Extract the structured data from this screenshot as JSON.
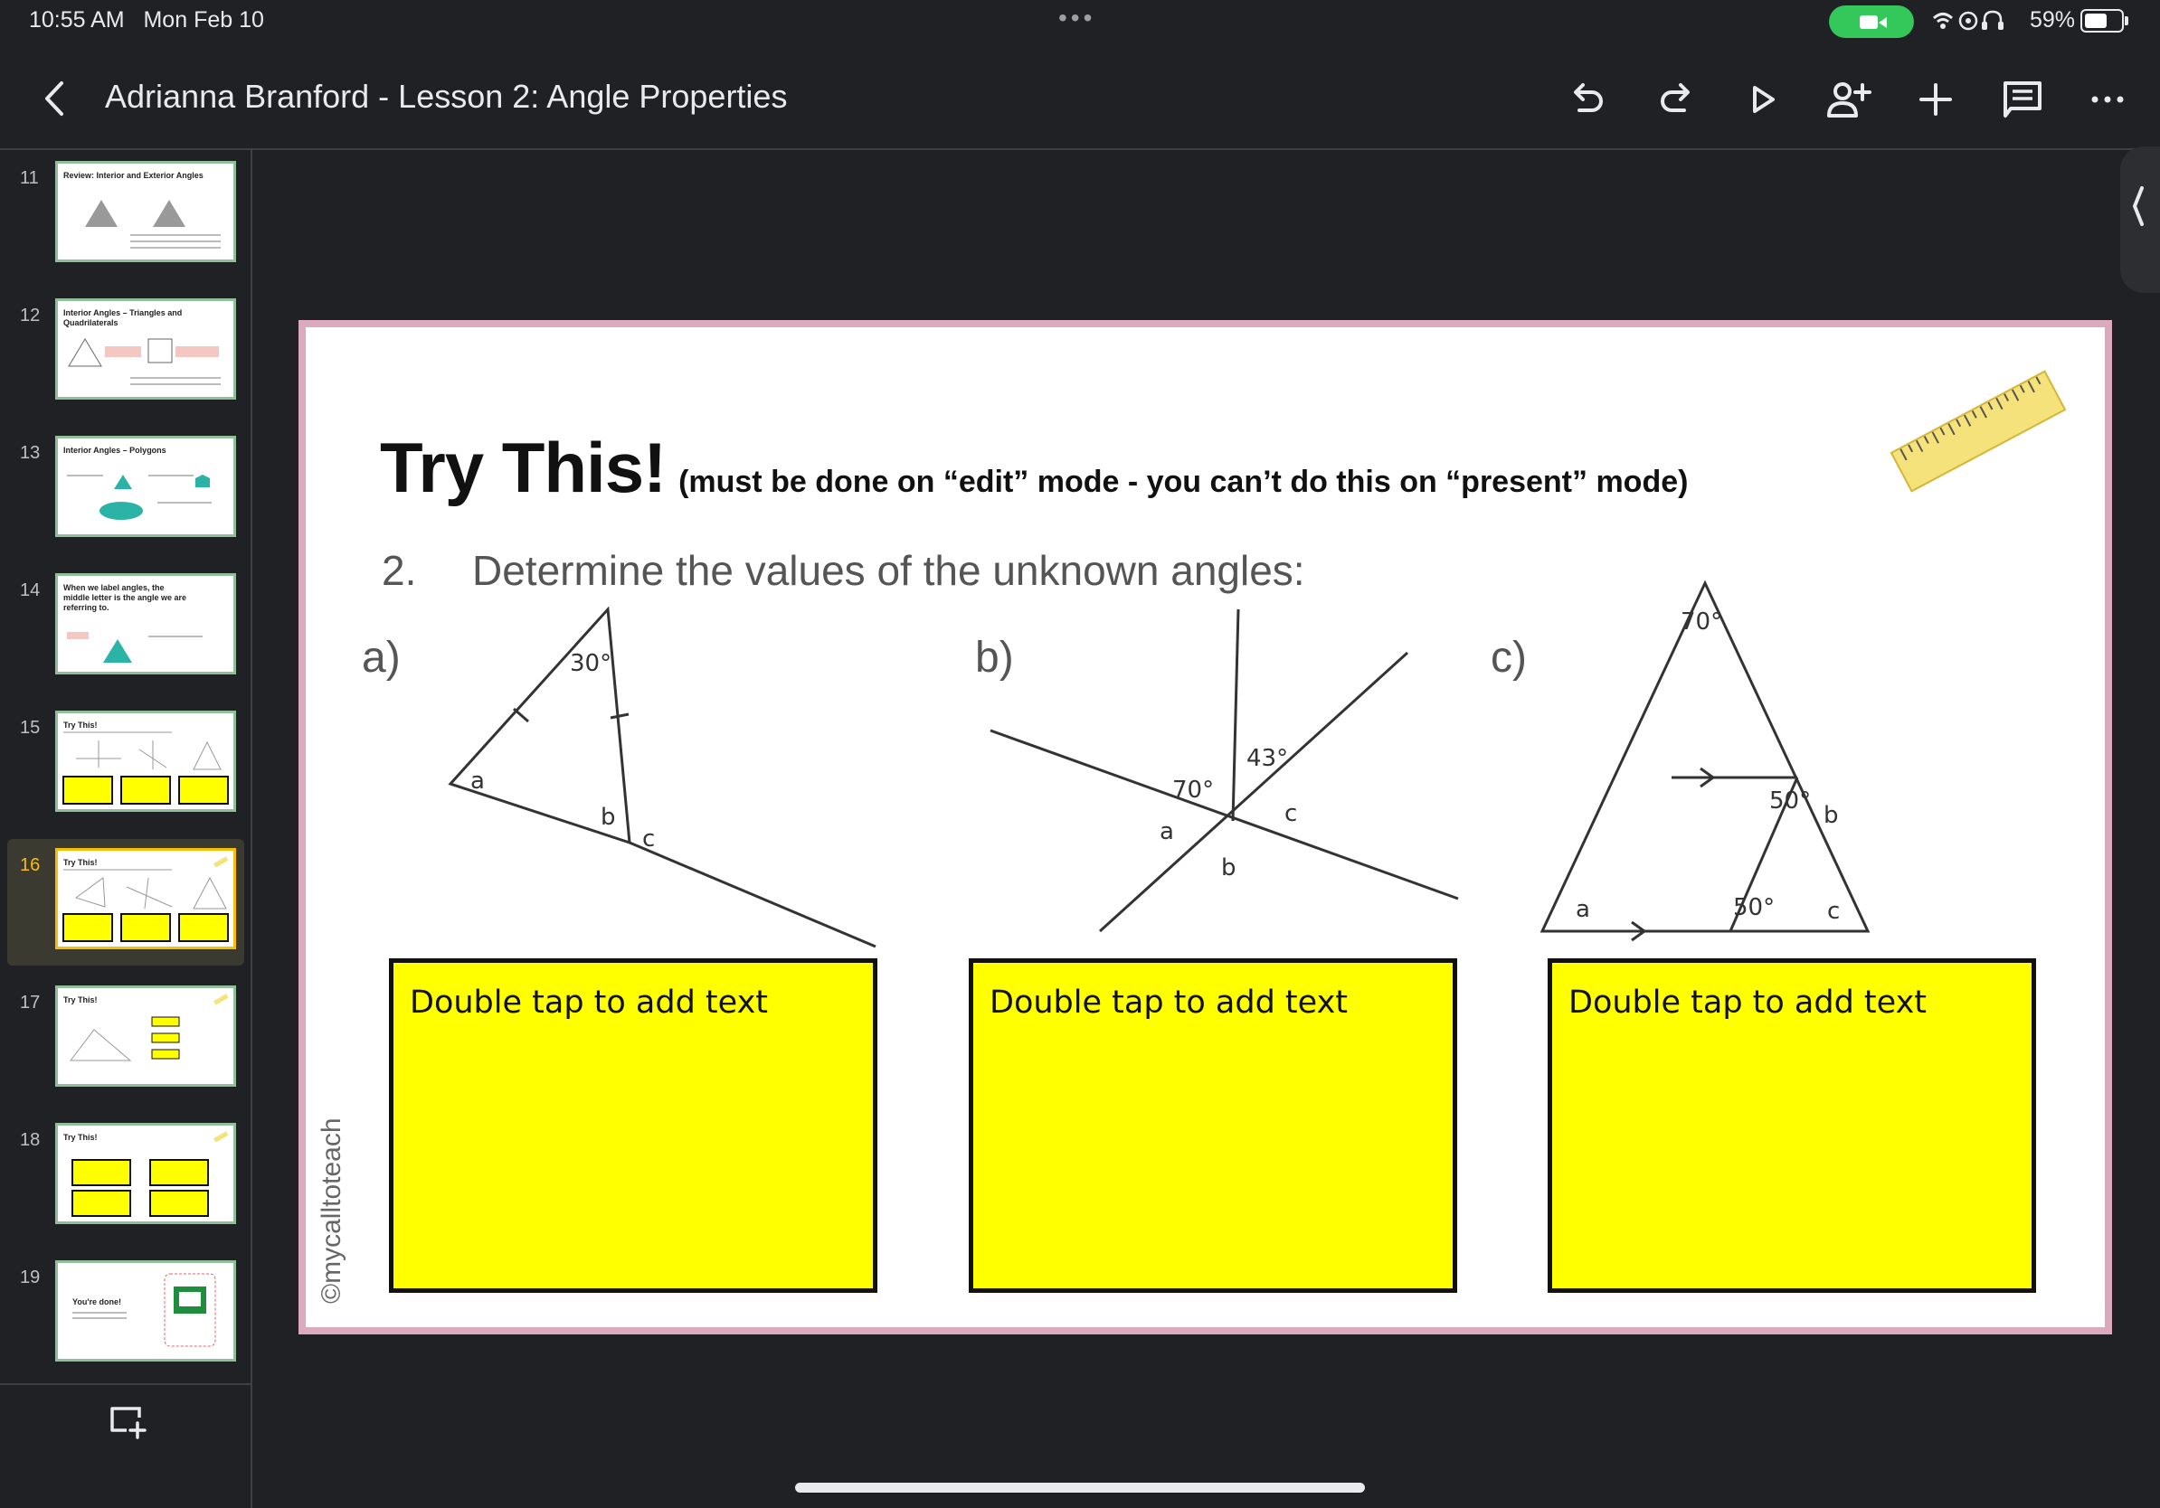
{
  "status": {
    "time": "10:55 AM",
    "date": "Mon Feb 10",
    "battery": "59%"
  },
  "toolbar": {
    "title": "Adrianna Branford - Lesson 2: Angle Properties"
  },
  "slides": [
    {
      "num": "11",
      "title": "Review: Interior and Exterior Angles"
    },
    {
      "num": "12",
      "title": "Interior Angles – Triangles and Quadrilaterals"
    },
    {
      "num": "13",
      "title": "Interior Angles – Polygons"
    },
    {
      "num": "14",
      "title": "When we label angles, the middle letter is the angle we are referring to."
    },
    {
      "num": "15",
      "title": "Try This!"
    },
    {
      "num": "16",
      "title": "Try This!"
    },
    {
      "num": "17",
      "title": "Try This!"
    },
    {
      "num": "18",
      "title": "Try This!"
    },
    {
      "num": "19",
      "title": "You're done!"
    }
  ],
  "selected_slide": "16",
  "slide": {
    "heading": "Try This!",
    "subheading": "(must be done on “edit” mode - you can’t do this on “present” mode)",
    "question_number": "2.",
    "question_text": "Determine the values of the unknown angles:",
    "parts": [
      "a)",
      "b)",
      "c)"
    ],
    "answer_placeholder": "Double tap to add text",
    "watermark": "©mycalltoteach",
    "diagram_a": {
      "given": [
        "30°"
      ],
      "unknowns": [
        "a",
        "b",
        "c"
      ]
    },
    "diagram_b": {
      "given": [
        "43°",
        "70°"
      ],
      "unknowns": [
        "a",
        "b",
        "c"
      ]
    },
    "diagram_c": {
      "given": [
        "70°",
        "50°",
        "50°"
      ],
      "unknowns": [
        "a",
        "b",
        "c"
      ]
    }
  }
}
